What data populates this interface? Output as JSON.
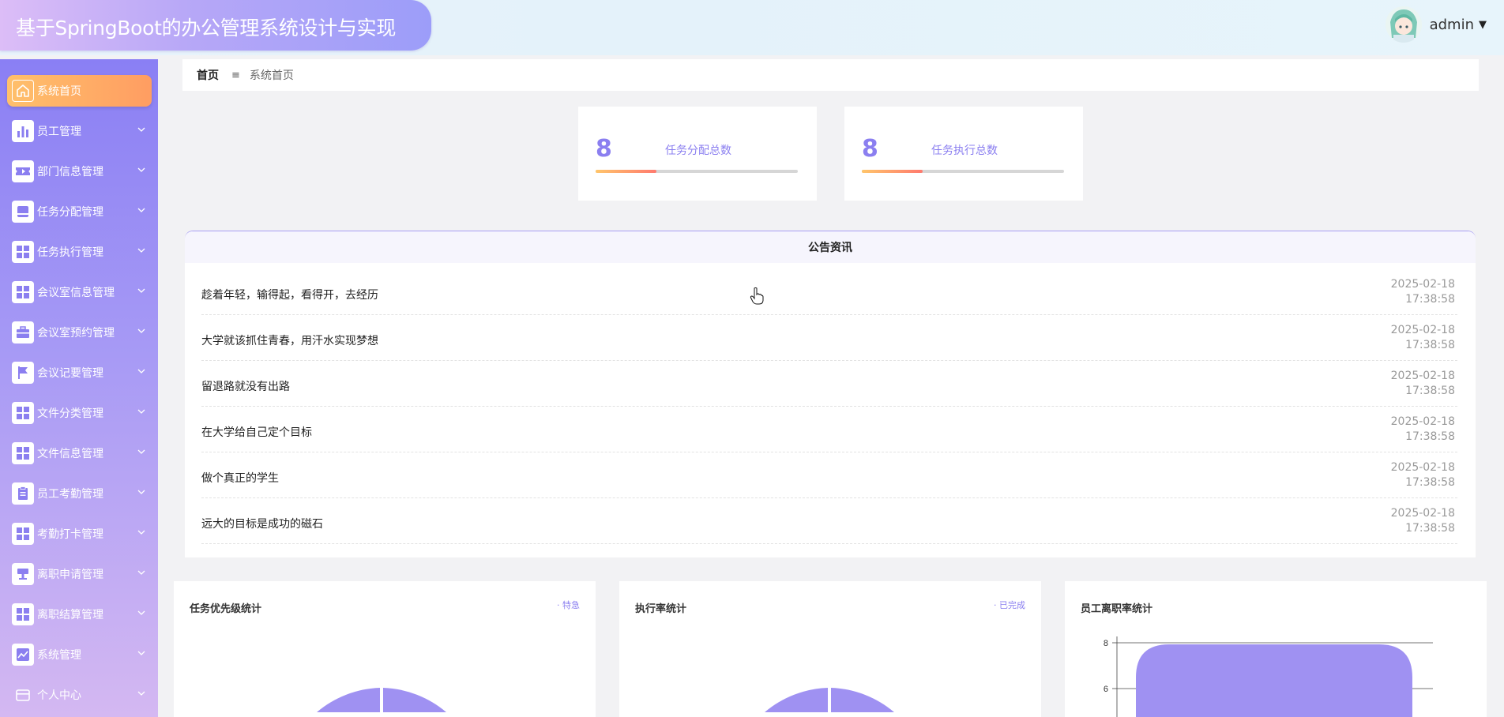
{
  "header": {
    "app_title": "基于SpringBoot的办公管理系统设计与实现",
    "user_name": "admin"
  },
  "sidebar": {
    "items": [
      {
        "label": "系统首页",
        "icon": "home-icon",
        "active": true
      },
      {
        "label": "员工管理",
        "icon": "bar-chart-icon"
      },
      {
        "label": "部门信息管理",
        "icon": "ticket-icon"
      },
      {
        "label": "任务分配管理",
        "icon": "inbox-icon"
      },
      {
        "label": "任务执行管理",
        "icon": "grid-icon"
      },
      {
        "label": "会议室信息管理",
        "icon": "grid-icon"
      },
      {
        "label": "会议室预约管理",
        "icon": "briefcase-icon"
      },
      {
        "label": "会议记要管理",
        "icon": "flag-icon"
      },
      {
        "label": "文件分类管理",
        "icon": "grid-icon"
      },
      {
        "label": "文件信息管理",
        "icon": "grid-icon"
      },
      {
        "label": "员工考勤管理",
        "icon": "clipboard-icon"
      },
      {
        "label": "考勤打卡管理",
        "icon": "grid-icon"
      },
      {
        "label": "离职申请管理",
        "icon": "stamp-icon"
      },
      {
        "label": "离职结算管理",
        "icon": "grid-icon"
      },
      {
        "label": "系统管理",
        "icon": "line-chart-icon"
      },
      {
        "label": "个人中心",
        "icon": "wallet-icon"
      }
    ]
  },
  "breadcrumb": {
    "home": "首页",
    "separator": "≡",
    "current": "系统首页"
  },
  "stats": [
    {
      "value": "8",
      "label": "任务分配总数",
      "progress": 0.3
    },
    {
      "value": "8",
      "label": "任务执行总数",
      "progress": 0.3
    }
  ],
  "notices": {
    "title": "公告资讯",
    "items": [
      {
        "title": "趁着年轻，输得起，看得开，去经历",
        "date": "2025-02-18",
        "time": "17:38:58"
      },
      {
        "title": "大学就该抓住青春，用汗水实现梦想",
        "date": "2025-02-18",
        "time": "17:38:58"
      },
      {
        "title": "留退路就没有出路",
        "date": "2025-02-18",
        "time": "17:38:58"
      },
      {
        "title": "在大学给自己定个目标",
        "date": "2025-02-18",
        "time": "17:38:58"
      },
      {
        "title": "做个真正的学生",
        "date": "2025-02-18",
        "time": "17:38:58"
      },
      {
        "title": "远大的目标是成功的磁石",
        "date": "2025-02-18",
        "time": "17:38:58"
      }
    ]
  },
  "charts": {
    "priority": {
      "title": "任务优先级统计",
      "legend": "· 特急"
    },
    "execution": {
      "title": "执行率统计",
      "legend": "· 已完成"
    },
    "resignation": {
      "title": "员工离职率统计",
      "ticks": [
        "8",
        "6"
      ]
    }
  },
  "colors": {
    "accent": "#8b7ff0",
    "chart_fill": "#9f91f2",
    "active_menu": "#ffb066"
  },
  "chart_data": [
    {
      "type": "pie",
      "title": "任务优先级统计",
      "labels": [
        "特急"
      ]
    },
    {
      "type": "pie",
      "title": "执行率统计",
      "labels": [
        "已完成"
      ]
    },
    {
      "type": "bar",
      "title": "员工离职率统计",
      "values": [
        8
      ],
      "ylim": [
        0,
        8
      ],
      "yticks": [
        6,
        8
      ]
    }
  ]
}
